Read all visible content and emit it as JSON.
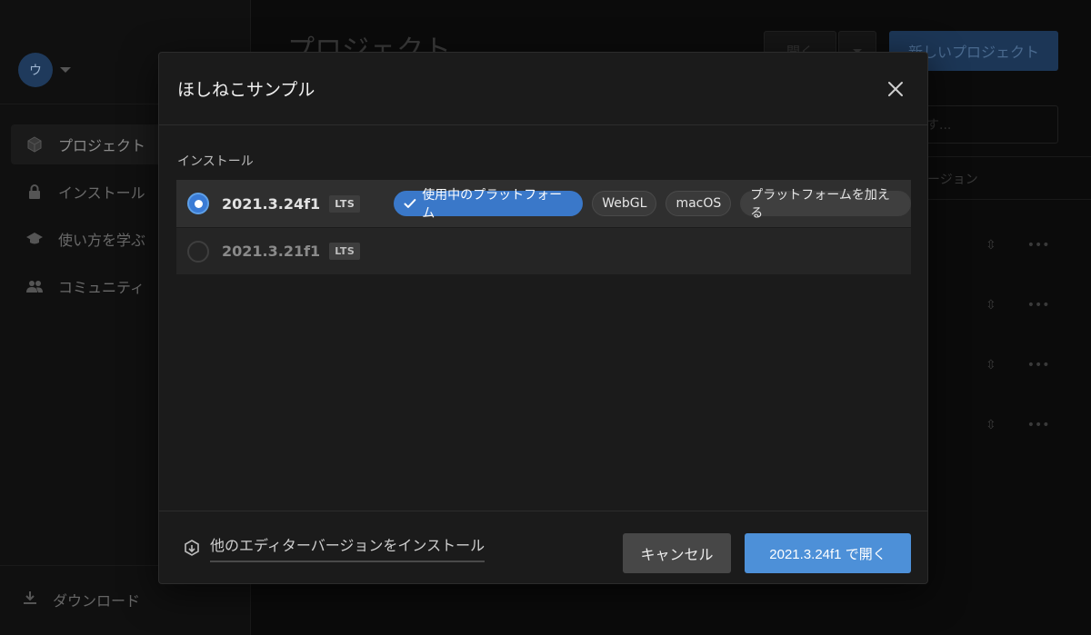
{
  "window": {
    "traffic_lights": {
      "close": "#ff5f57",
      "minimize": "#febc2e",
      "zoom": "#28c840"
    }
  },
  "sidebar": {
    "avatar_letter": "ウ",
    "items": [
      {
        "label": "プロジェクト",
        "icon": "cube-icon",
        "active": true
      },
      {
        "label": "インストール",
        "icon": "lock-icon",
        "active": false
      },
      {
        "label": "使い方を学ぶ",
        "icon": "graduation-cap-icon",
        "active": false
      },
      {
        "label": "コミュニティ",
        "icon": "people-icon",
        "active": false
      }
    ],
    "download_label": "ダウンロード"
  },
  "main": {
    "title": "プロジェクト",
    "open_label": "開く",
    "new_project_label": "新しいプロジェクト",
    "search_placeholder": "す...",
    "version_column": "ージョン"
  },
  "modal": {
    "title": "ほしねこサンプル",
    "section_label": "インストール",
    "versions": [
      {
        "version": "2021.3.24f1",
        "badge": "LTS",
        "selected": true,
        "chips": {
          "in_use": "使用中のプラットフォーム",
          "webgl": "WebGL",
          "macos": "macOS",
          "add": "プラットフォームを加える"
        }
      },
      {
        "version": "2021.3.21f1",
        "badge": "LTS",
        "selected": false
      }
    ],
    "install_other_label": "他のエディターバージョンをインストール",
    "cancel_label": "キャンセル",
    "open_label": "2021.3.24f1 で開く"
  },
  "colors": {
    "accent": "#3a78c9",
    "primary_button": "#4d90d8",
    "modal_bg": "#1b1b1b"
  }
}
